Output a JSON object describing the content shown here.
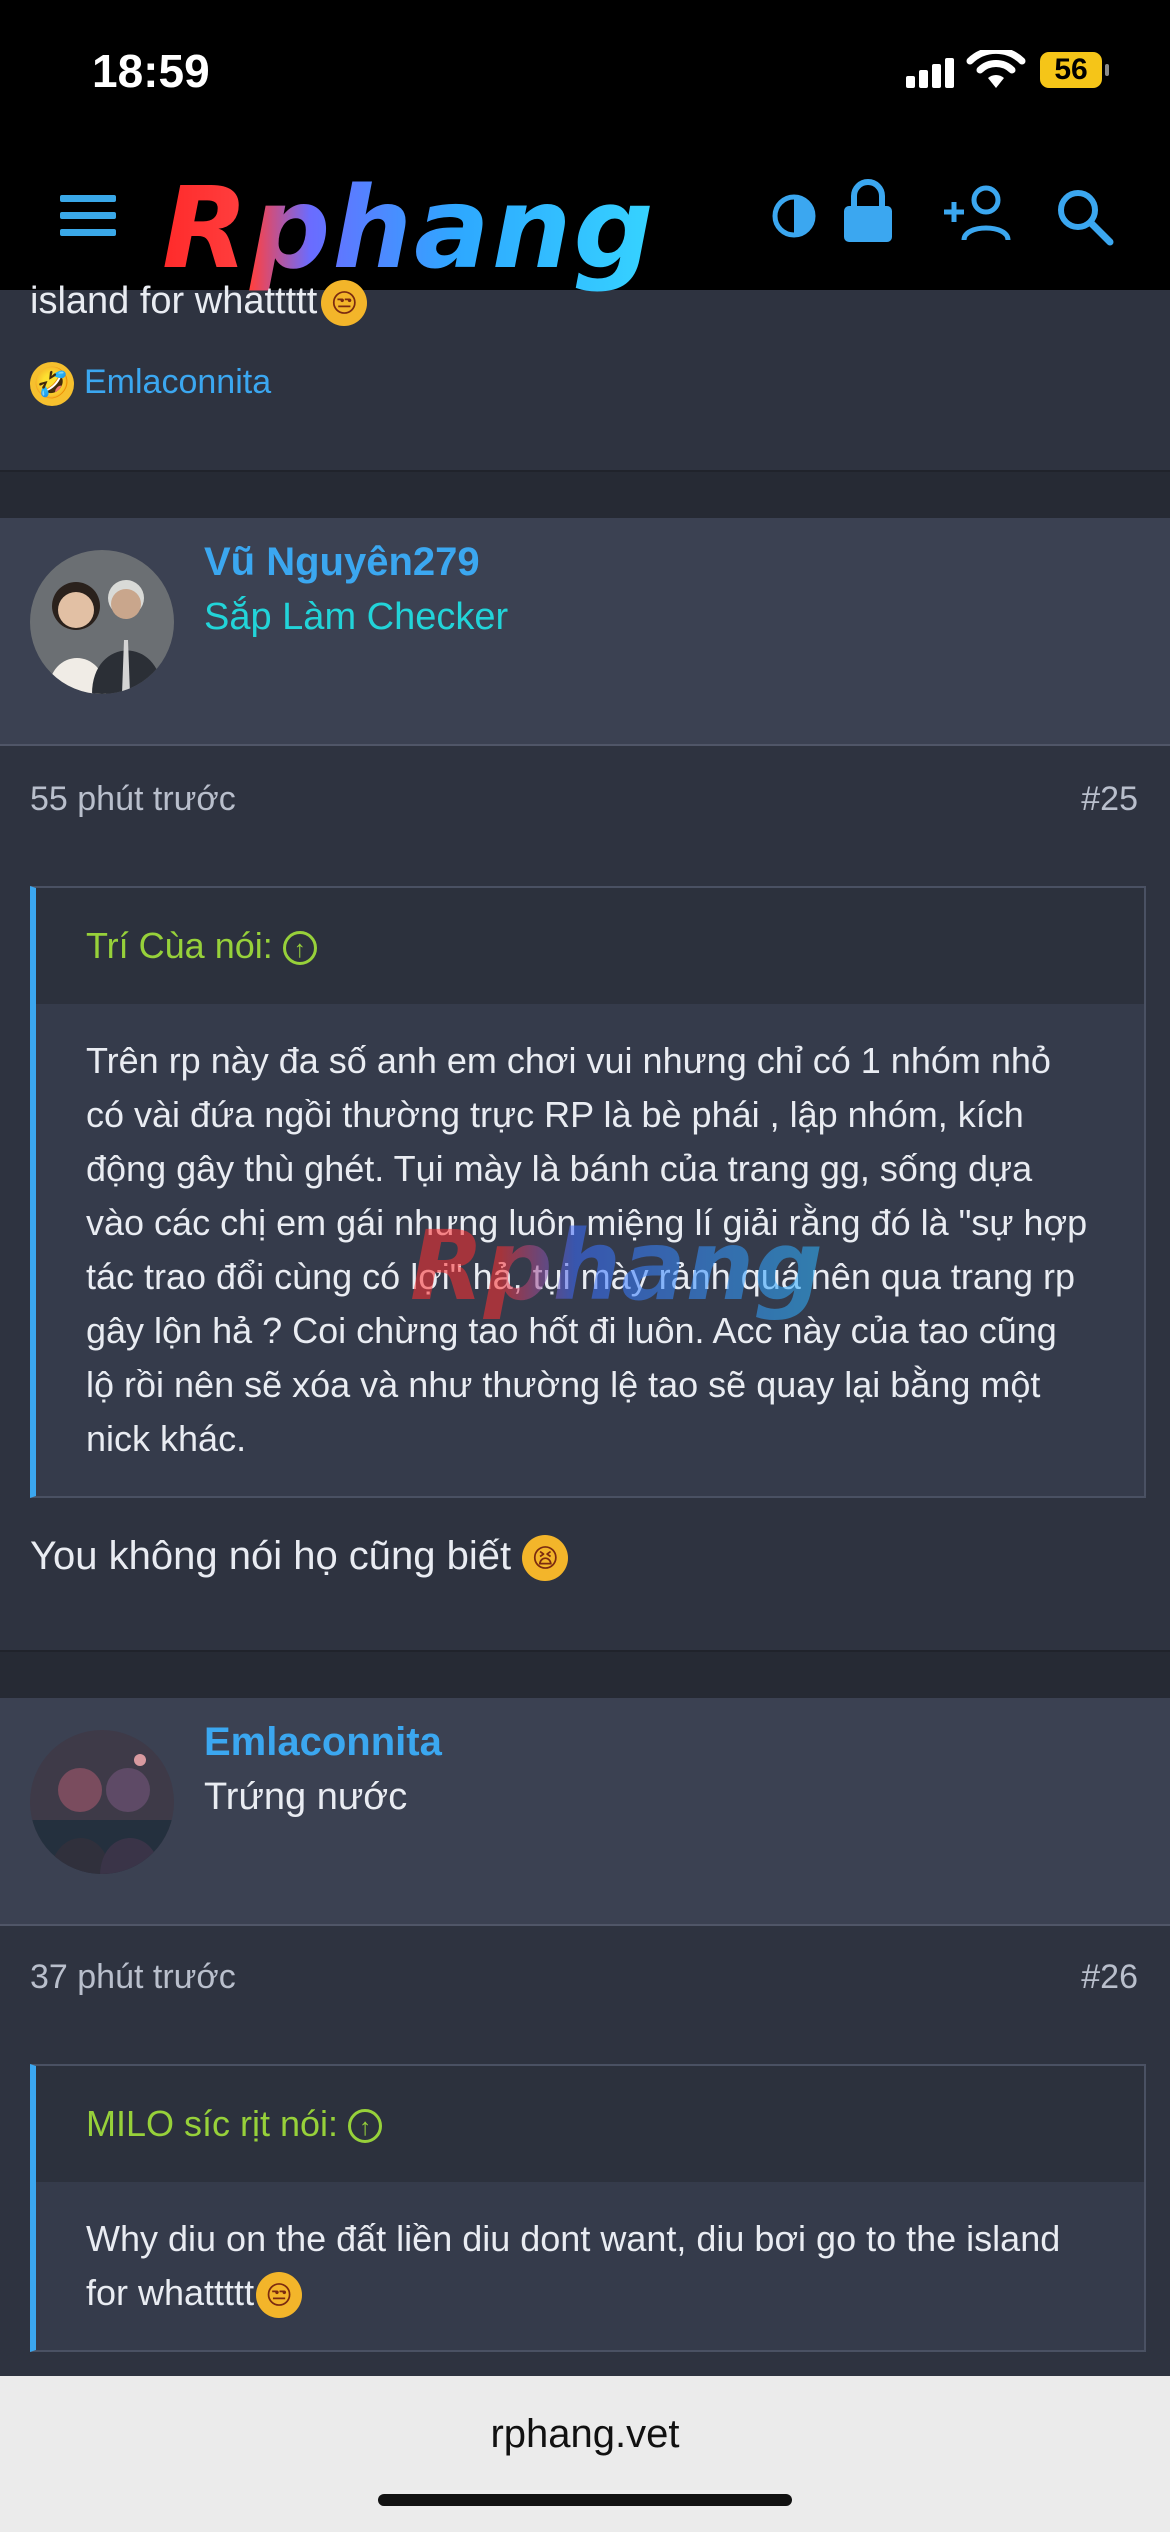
{
  "status_bar": {
    "time": "18:59",
    "battery": "56"
  },
  "header": {
    "logo_text": "Rphang"
  },
  "prev_post": {
    "tail_text": "island for whattttt",
    "reaction_user": "Emlaconnita"
  },
  "posts": [
    {
      "username": "Vũ Nguyên279",
      "user_title": "Sắp Làm Checker",
      "time": "55 phút trước",
      "number": "#25",
      "quote_author": "Trí Cùa nói:",
      "quote_text": "Trên rp này đa số anh em chơi vui nhưng chỉ có 1 nhóm nhỏ có vài đứa ngồi thường trực RP là bè phái , lập nhóm, kích động gây thù ghét. Tụi mày là bánh của trang gg, sống dựa vào các chị em gái nhưng luôn miệng lí giải rằng đó là \"sự hợp tác trao đổi cùng có lợi\" hả, tụi mày rảnh quá nên qua trang rp gây lộn hả ? Coi chừng tao hốt đi luôn. Acc này của tao cũng lộ rồi nên sẽ xóa và như thường lệ tao sẽ quay lại bằng một nick khác.",
      "body": "You không nói họ cũng biết"
    },
    {
      "username": "Emlaconnita",
      "user_title": "Trứng nước",
      "time": "37 phút trước",
      "number": "#26",
      "quote_author": "MILO síc rịt nói:",
      "quote_text": "Why diu on the đất liền diu dont want, diu bơi go to the island for whattttt"
    }
  ],
  "watermark": "Rphang",
  "browser": {
    "url": "rphang.vet"
  }
}
